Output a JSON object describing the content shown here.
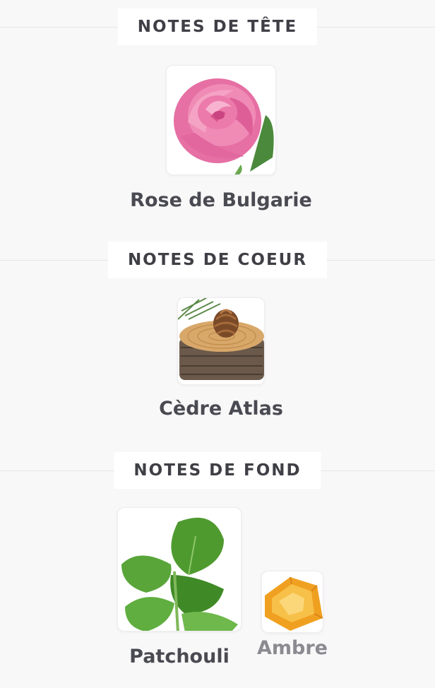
{
  "sections": [
    {
      "heading": "NOTES DE TÊTE",
      "notes": [
        {
          "label": "Rose de Bulgarie",
          "icon": "rose-icon"
        }
      ]
    },
    {
      "heading": "NOTES DE COEUR",
      "notes": [
        {
          "label": "Cèdre Atlas",
          "icon": "cedar-log-pinecone-icon"
        }
      ]
    },
    {
      "heading": "NOTES DE FOND",
      "notes": [
        {
          "label": "Patchouli",
          "icon": "patchouli-leaf-icon"
        },
        {
          "label": "Ambre",
          "icon": "amber-resin-icon"
        }
      ]
    }
  ],
  "colors": {
    "background": "#f9f8f9",
    "heading_text": "#3f3f46",
    "label_text": "#4a4a52",
    "label_dim": "#8a8a90"
  }
}
